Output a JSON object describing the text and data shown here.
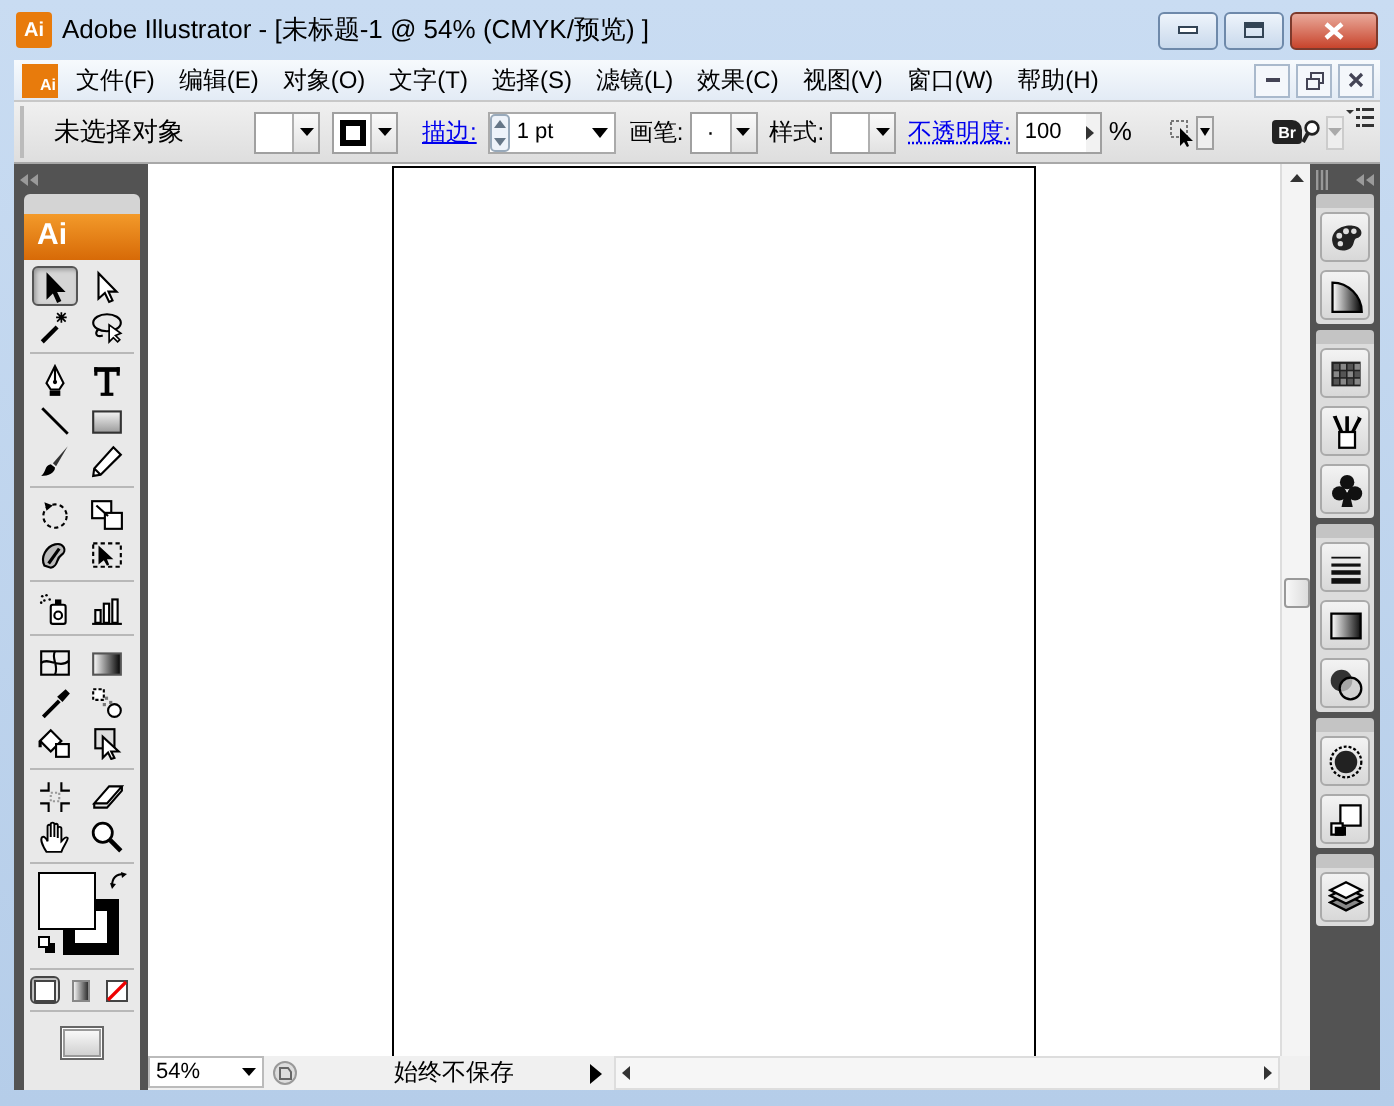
{
  "window": {
    "app_icon": "Ai",
    "title": "Adobe Illustrator - [未标题-1 @ 54% (CMYK/预览) ]"
  },
  "menu_bar": {
    "doc_icon": "Ai",
    "items": [
      "文件(F)",
      "编辑(E)",
      "对象(O)",
      "文字(T)",
      "选择(S)",
      "滤镜(L)",
      "效果(C)",
      "视图(V)",
      "窗口(W)",
      "帮助(H)"
    ]
  },
  "control_bar": {
    "selection": "未选择对象",
    "stroke_label": "描边:",
    "stroke_weight": "1 pt",
    "brush_label": "画笔:",
    "brush_value": "·",
    "style_label": "样式:",
    "opacity_label": "不透明度:",
    "opacity": "100",
    "percent": "%",
    "bridge": "Br"
  },
  "tools_panel": {
    "logo": "Ai",
    "groups": [
      [
        {
          "kind": "arrow",
          "selected": true
        },
        {
          "kind": "hollow-arrow",
          "selected": false
        },
        {
          "kind": "magic-wand",
          "selected": false
        },
        {
          "kind": "lasso",
          "selected": false
        }
      ],
      [
        {
          "kind": "pen",
          "selected": false
        },
        {
          "kind": "type",
          "selected": false
        },
        {
          "kind": "line",
          "selected": false
        },
        {
          "kind": "rectangle",
          "selected": false
        },
        {
          "kind": "brush",
          "selected": false
        },
        {
          "kind": "pencil",
          "selected": false
        }
      ],
      [
        {
          "kind": "rotate",
          "selected": false
        },
        {
          "kind": "scale",
          "selected": false
        },
        {
          "kind": "warp",
          "selected": false
        },
        {
          "kind": "transform",
          "selected": false
        }
      ],
      [
        {
          "kind": "spray",
          "selected": false
        },
        {
          "kind": "bar-chart",
          "selected": false
        }
      ],
      [
        {
          "kind": "mesh",
          "selected": false
        },
        {
          "kind": "gradient",
          "selected": false
        },
        {
          "kind": "eyedropper",
          "selected": false
        },
        {
          "kind": "blend",
          "selected": false
        },
        {
          "kind": "paint-bucket",
          "selected": false
        },
        {
          "kind": "live-select",
          "selected": false
        }
      ],
      [
        {
          "kind": "crop-marks",
          "selected": false
        },
        {
          "kind": "eraser",
          "selected": false
        },
        {
          "kind": "hand",
          "selected": false
        },
        {
          "kind": "zoom",
          "selected": false
        }
      ]
    ],
    "modes": [
      {
        "kind": "color",
        "selected": true
      },
      {
        "kind": "gradient",
        "selected": false
      },
      {
        "kind": "none",
        "selected": false
      }
    ]
  },
  "right_panel": {
    "groups": [
      [
        {
          "kind": "palette"
        },
        {
          "kind": "color-guide"
        }
      ],
      [
        {
          "kind": "swatches"
        },
        {
          "kind": "brushes"
        },
        {
          "kind": "club"
        }
      ],
      [
        {
          "kind": "stroke"
        },
        {
          "kind": "gradient"
        },
        {
          "kind": "overlap"
        }
      ],
      [
        {
          "kind": "appearance"
        },
        {
          "kind": "styles"
        }
      ],
      [
        {
          "kind": "layers"
        }
      ]
    ]
  },
  "status_bar": {
    "zoom": "54%",
    "status": "始终不保存"
  }
}
